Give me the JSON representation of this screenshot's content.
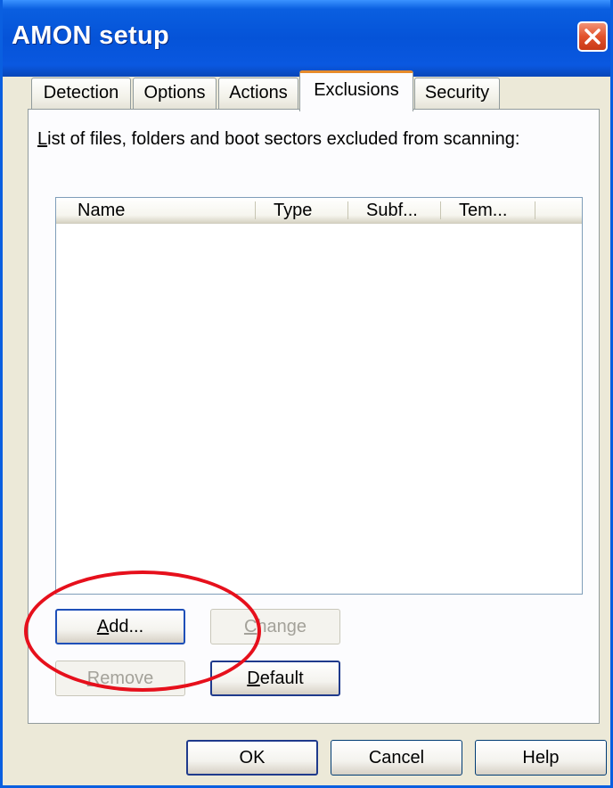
{
  "window": {
    "title": "AMON setup"
  },
  "tabs": [
    {
      "label": "Detection",
      "active": false
    },
    {
      "label": "Options",
      "active": false
    },
    {
      "label": "Actions",
      "active": false
    },
    {
      "label": "Exclusions",
      "active": true
    },
    {
      "label": "Security",
      "active": false
    }
  ],
  "exclusions": {
    "caption_first": "L",
    "caption_rest": "ist of files, folders and boot sectors excluded from scanning:",
    "columns": [
      "Name",
      "Type",
      "Subf...",
      "Tem..."
    ],
    "rows": []
  },
  "buttons": {
    "add_first": "A",
    "add_rest": "dd...",
    "change_first": "C",
    "change_rest": "hange",
    "remove_first": "R",
    "remove_rest": "emove",
    "default_first": "D",
    "default_rest": "efault",
    "ok": "OK",
    "cancel": "Cancel",
    "help": "Help"
  },
  "icons": {
    "close": "close-icon"
  },
  "colors": {
    "titlebar": "#0553D8",
    "active_tab_accent": "#E68B2C",
    "highlight_ring": "#E6101C",
    "dialog_face": "#ECE9D8"
  }
}
